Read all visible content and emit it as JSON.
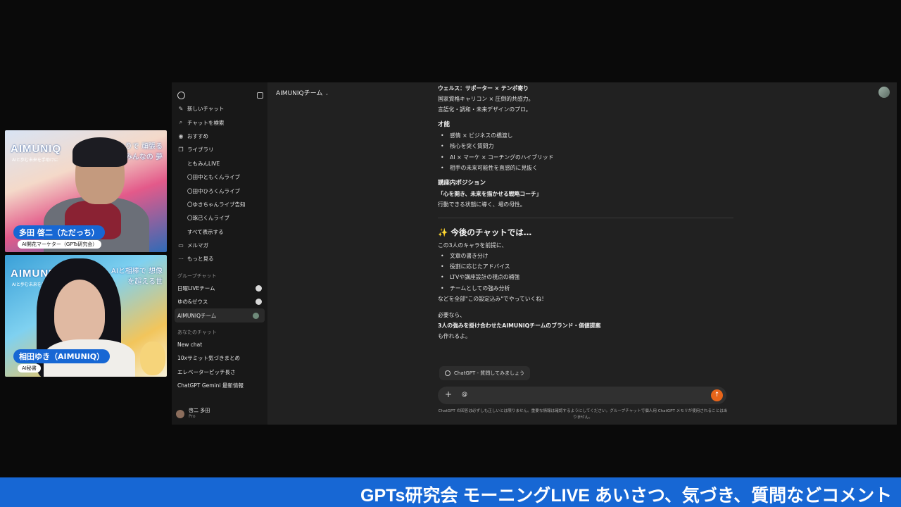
{
  "webcams": [
    {
      "brand": "AIMUNIQ",
      "brand_sub": "AIと歩む未来を手助けに",
      "tagline": "ひとりで 頑張る みんなの 夢",
      "name": "多田 啓二（ただっち）",
      "role": "AI開花マーケター（GPTs研究会）"
    },
    {
      "brand": "AIMUNIQ",
      "brand_sub": "AIと歩む未来を手助けに",
      "tagline": "AIと相棒で 想像を超える世",
      "name": "相田ゆき（AIMUNIQ）",
      "role": "AI秘書"
    }
  ],
  "sidebar": {
    "top_items": [
      {
        "icon": "new-chat-icon",
        "glyph": "✎",
        "label": "新しいチャット"
      },
      {
        "icon": "search-icon",
        "glyph": "⌕",
        "label": "チャットを検索"
      },
      {
        "icon": "broadcast-icon",
        "glyph": "◉",
        "label": "おすすめ"
      },
      {
        "icon": "library-icon",
        "glyph": "❐",
        "label": "ライブラリ"
      }
    ],
    "library_items": [
      "ともみんLIVE",
      "〇田中ともくんライブ",
      "〇田中ひろくんライブ",
      "〇ゆきちゃんライブ告知",
      "〇琢己くんライブ",
      "すべて表示する"
    ],
    "bottom_items": [
      {
        "icon": "folder-icon",
        "glyph": "▭",
        "label": "メルマガ"
      },
      {
        "icon": "more-icon",
        "glyph": "⋯",
        "label": "もっと見る"
      }
    ],
    "group_section_label": "グループチャット",
    "group_chats": [
      "日曜LIVEチーム",
      "ゆの&ゼウス",
      "AIMUNIQチーム"
    ],
    "your_chats_label": "あなたのチャット",
    "your_chats": [
      "New chat",
      "10xサミット気づきまとめ",
      "エレベーターピッチ長さ",
      "ChatGPT Gemini 最新情報"
    ],
    "user_name": "啓二 多田",
    "user_plan": "Pro"
  },
  "main": {
    "title": "AIMUNIQチーム",
    "message": {
      "intro_bold": "ウェルス：サポーター × テンポ寄り",
      "intro_lines": [
        "国家資格キャリコン × 圧倒的共感力。",
        "言語化・調和・未来デザインのプロ。"
      ],
      "talent_heading": "才能",
      "talent_items": [
        "感情 × ビジネスの橋渡し",
        "核心を突く質問力",
        "AI × マーケ × コーチングのハイブリッド",
        "相手の未来可能性を直感的に見抜く"
      ],
      "position_heading": "講座内ポジション",
      "position_quote": "「心を開き、未来を描かせる戦略コーチ」",
      "position_line": "行動できる状態に導く、場の母性。",
      "future_heading_icon": "✨",
      "future_heading": "今後のチャットでは…",
      "future_intro": "この3人のキャラを前提に、",
      "future_items": [
        "文章の書き分け",
        "役割に応じたアドバイス",
        "LTVや講座設計の視点の補強",
        "チームとしての強み分析"
      ],
      "future_close": "などを全部\"この設定込み\"でやっていくね！",
      "offer_line1": "必要なら、",
      "offer_bold": "3人の強みを掛け合わせたAIMUNIQチームのブランド・価値提案",
      "offer_line3": "も作れるよ。"
    },
    "chip_label": "ChatGPT - 質問してみましょう",
    "composer_value": "@",
    "disclaimer": "ChatGPT の回答は必ずしも正しいとは限りません。重要な情報は確認するようにしてください。グループチャットで個人用 ChatGPT メモリが使用されることはありません。"
  },
  "ticker": "GPTs研究会 モーニングLIVE あいさつ、気づき、質問などコメント",
  "colors": {
    "ticker_bg": "#1767d4",
    "name_tag_bg": "#1767d4",
    "send_button": "#e8651a",
    "app_bg": "#212121",
    "sidebar_bg": "#181818"
  }
}
